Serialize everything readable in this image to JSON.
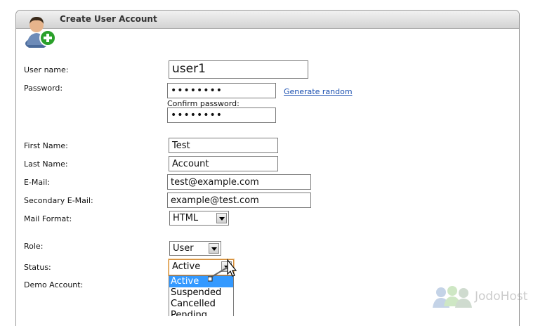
{
  "panel": {
    "title": "Create User Account"
  },
  "form": {
    "username": {
      "label": "User name:",
      "value": "user1"
    },
    "password": {
      "label": "Password:",
      "value": "••••••••",
      "generate_link": "Generate random"
    },
    "confirm_password": {
      "label": "Confirm password:",
      "value": "••••••••"
    },
    "first_name": {
      "label": "First Name:",
      "value": "Test"
    },
    "last_name": {
      "label": "Last Name:",
      "value": "Account"
    },
    "email": {
      "label": "E-Mail:",
      "value": "test@example.com"
    },
    "secondary_email": {
      "label": "Secondary E-Mail:",
      "value": "example@test.com"
    },
    "mail_format": {
      "label": "Mail Format:",
      "value": "HTML"
    },
    "role": {
      "label": "Role:",
      "value": "User"
    },
    "status": {
      "label": "Status:",
      "value": "Active",
      "options": [
        "Active",
        "Suspended",
        "Cancelled",
        "Pending"
      ]
    },
    "demo_account": {
      "label": "Demo Account:"
    }
  },
  "watermark": {
    "text": "JodoHost"
  },
  "icons": {
    "user_add": "user-add-icon",
    "cursor": "cursor-icon",
    "watermark": "people-icon"
  }
}
